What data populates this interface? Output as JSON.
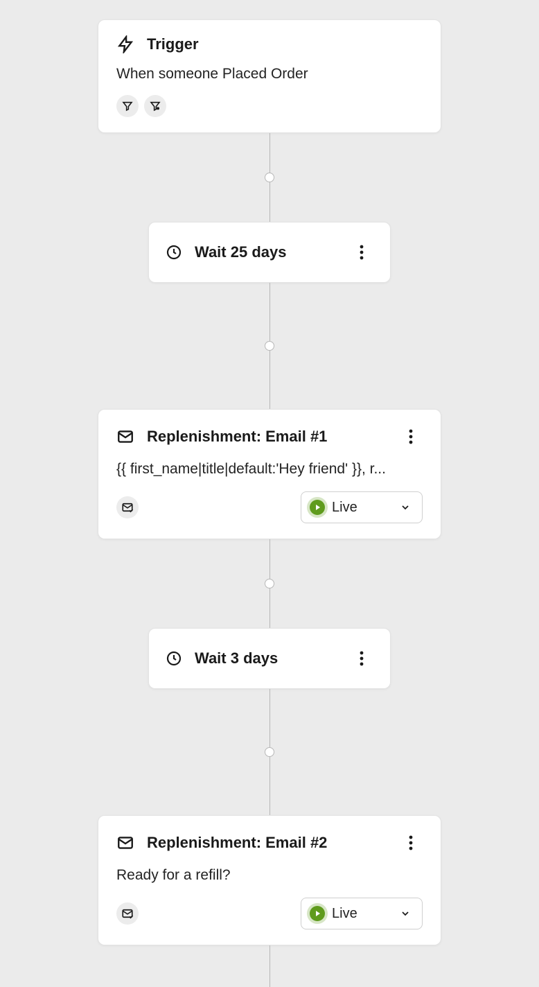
{
  "trigger": {
    "title": "Trigger",
    "description": "When someone Placed Order"
  },
  "steps": [
    {
      "type": "wait",
      "label": "Wait 25 days"
    },
    {
      "type": "email",
      "title": "Replenishment: Email #1",
      "preview": "{{ first_name|title|default:'Hey friend' }}, r...",
      "status": "Live"
    },
    {
      "type": "wait",
      "label": "Wait 3 days"
    },
    {
      "type": "email",
      "title": "Replenishment: Email #2",
      "preview": "Ready for a refill?",
      "status": "Live"
    }
  ]
}
